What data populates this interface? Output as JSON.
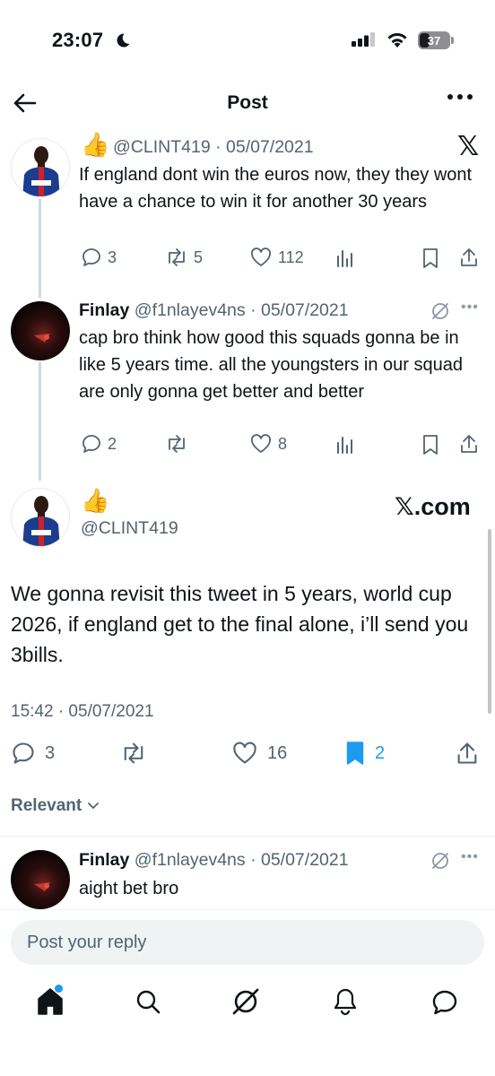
{
  "status_bar": {
    "time": "23:07",
    "battery": "37"
  },
  "header": {
    "title": "Post"
  },
  "quoted_tweet": {
    "emoji": "👍",
    "handle_date": "@CLINT419 · 05/07/2021",
    "text": "If england dont win the euros now, they they wont have a chance to win it for another 30 years",
    "replies": "3",
    "reposts": "5",
    "likes": "112",
    "source_logo": "𝕏"
  },
  "reply_tweet": {
    "name": "Finlay",
    "handle_date": "@f1nlayev4ns · 05/07/2021",
    "text": "cap bro think how good this squads gonna be in like 5 years time. all the youngsters in our squad are only gonna get better and better",
    "replies": "2",
    "reposts": "",
    "likes": "8"
  },
  "main_tweet": {
    "emoji": "👍",
    "handle": "@CLINT419",
    "source_logo": "𝕏.com",
    "text": "We gonna revisit this tweet in 5 years, world cup 2026, if england get to the final alone, i’ll send you 3bills.",
    "timestamp": "15:42 · 05/07/2021",
    "replies": "3",
    "reposts": "",
    "likes": "16",
    "bookmarks": "2"
  },
  "sort": {
    "label": "Relevant"
  },
  "comment": {
    "name": "Finlay",
    "handle_date": "@f1nlayev4ns · 05/07/2021",
    "text": "aight bet bro"
  },
  "reply_input": {
    "placeholder": "Post your reply"
  },
  "colors": {
    "accent": "#1d9bf0",
    "text": "#0f1419",
    "muted": "#536471",
    "line": "#cfd9de"
  },
  "icons": [
    "back-arrow-icon",
    "more-icon",
    "reply-icon",
    "repost-icon",
    "like-icon",
    "views-icon",
    "bookmark-icon",
    "share-icon",
    "grok-icon",
    "home-icon",
    "search-icon",
    "notifications-icon",
    "messages-icon"
  ]
}
